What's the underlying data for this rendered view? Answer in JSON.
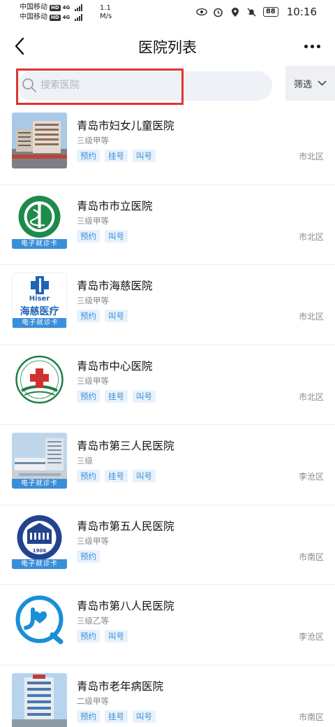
{
  "status_bar": {
    "carrier_1": "中国移动",
    "carrier_2": "中国移动",
    "hd": "HD",
    "net": "4G",
    "speed_value": "1.1",
    "speed_unit": "M/s",
    "battery": "88",
    "time": "10:16"
  },
  "nav": {
    "title": "医院列表"
  },
  "search": {
    "placeholder": "搜索医院",
    "filter_label": "筛选"
  },
  "card_label": "电子就诊卡",
  "hospitals": [
    {
      "name": "青岛市妇女儿童医院",
      "level": "三级甲等",
      "tags": [
        "预约",
        "挂号",
        "叫号"
      ],
      "district": "市北区",
      "has_card": false,
      "thumb": "building-photo-icon"
    },
    {
      "name": "青岛市市立医院",
      "level": "三级甲等",
      "tags": [
        "预约",
        "叫号"
      ],
      "district": "市北区",
      "has_card": true,
      "thumb": "municipal-hospital-logo-icon"
    },
    {
      "name": "青岛市海慈医院",
      "level": "三级甲等",
      "tags": [
        "预约",
        "叫号"
      ],
      "district": "市北区",
      "has_card": true,
      "thumb": "hiser-logo-icon",
      "logo_text_1": "Hiser",
      "logo_text_2": "海慈医疗"
    },
    {
      "name": "青岛市中心医院",
      "level": "三级甲等",
      "tags": [
        "预约",
        "挂号",
        "叫号"
      ],
      "district": "市北区",
      "has_card": false,
      "thumb": "central-hospital-logo-icon"
    },
    {
      "name": "青岛市第三人民医院",
      "level": "三级",
      "tags": [
        "预约",
        "挂号",
        "叫号"
      ],
      "district": "李沧区",
      "has_card": true,
      "thumb": "building-photo-icon"
    },
    {
      "name": "青岛市第五人民医院",
      "level": "三级甲等",
      "tags": [
        "预约"
      ],
      "district": "市南区",
      "has_card": true,
      "thumb": "fifth-hospital-logo-icon",
      "logo_year": "1906"
    },
    {
      "name": "青岛市第八人民医院",
      "level": "三级乙等",
      "tags": [
        "预约",
        "叫号"
      ],
      "district": "李沧区",
      "has_card": false,
      "thumb": "eighth-hospital-logo-icon"
    },
    {
      "name": "青岛市老年病医院",
      "level": "二级甲等",
      "tags": [
        "预约",
        "挂号",
        "叫号"
      ],
      "district": "市南区",
      "has_card": false,
      "thumb": "building-photo-icon"
    }
  ],
  "colors": {
    "accent": "#3a8ed8",
    "tag_bg": "#e8f2fc",
    "highlight": "#e0342f"
  }
}
